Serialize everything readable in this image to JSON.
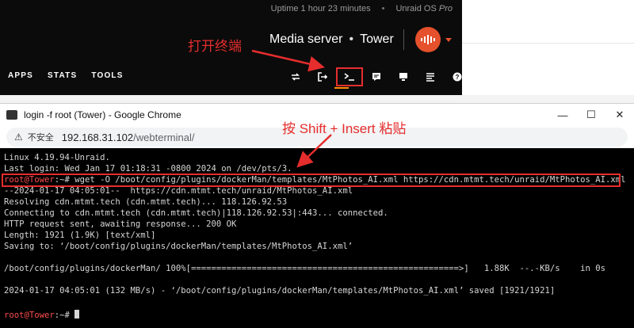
{
  "unraid": {
    "uptime": "Uptime 1 hour 23 minutes",
    "os": "Unraid OS",
    "os_edition": "Pro",
    "server_desc": "Media server",
    "server_name": "Tower",
    "menu": [
      "APPS",
      "STATS",
      "TOOLS"
    ],
    "toolbar_icons": [
      "swap-icon",
      "logout-icon",
      "terminal-icon",
      "feedback-icon",
      "display-icon",
      "log-icon",
      "help-icon"
    ]
  },
  "chrome": {
    "title": "login -f root (Tower) - Google Chrome",
    "security_label": "不安全",
    "url_host": "192.168.31.102",
    "url_path": "/webterminal/",
    "window_buttons": [
      "—",
      "☐",
      "✕"
    ]
  },
  "terminal": {
    "lines": [
      "Linux 4.19.94-Unraid.",
      "Last login: Wed Jan 17 01:18:31 -0800 2024 on /dev/pts/3.",
      "",
      "--2024-01-17 04:05:01--  https://cdn.mtmt.tech/unraid/MtPhotos_AI.xml",
      "Resolving cdn.mtmt.tech (cdn.mtmt.tech)... 118.126.92.53",
      "Connecting to cdn.mtmt.tech (cdn.mtmt.tech)|118.126.92.53|:443... connected.",
      "HTTP request sent, awaiting response... 200 OK",
      "Length: 1921 (1.9K) [text/xml]",
      "Saving to: ‘/boot/config/plugins/dockerMan/templates/MtPhotos_AI.xml’",
      "",
      "/boot/config/plugins/dockerMan/ 100%[=====================================================>]   1.88K  --.-KB/s    in 0s",
      "",
      "2024-01-17 04:05:01 (132 MB/s) - ‘/boot/config/plugins/dockerMan/templates/MtPhotos_AI.xml’ saved [1921/1921]",
      "",
      ""
    ],
    "prompt_user": "root@Tower",
    "prompt_suffix": ":~# ",
    "command": "wget -O /boot/config/plugins/dockerMan/templates/MtPhotos_AI.xml https://cdn.mtmt.tech/unraid/MtPhotos_AI.xml"
  },
  "annotations": {
    "open_terminal": "打开终端",
    "paste_hint": "按 Shift + Insert 粘贴",
    "accent": "#e62d2d"
  }
}
